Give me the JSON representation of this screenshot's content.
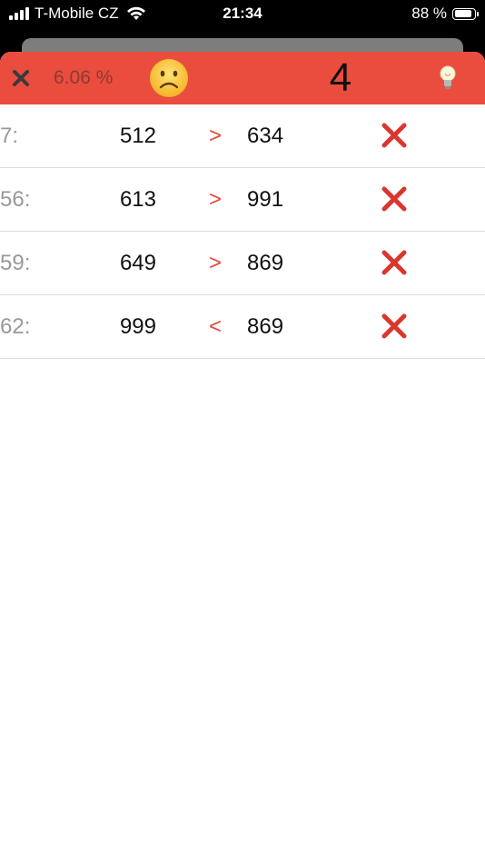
{
  "status": {
    "carrier": "T-Mobile CZ",
    "time": "21:34",
    "battery": "88 %",
    "battery_level": 0.88
  },
  "header": {
    "percent": "6.06 %",
    "counter": "4",
    "close_icon": "close-icon",
    "face_icon": "frowning-face-icon",
    "hint_icon": "lightbulb-icon",
    "color": "#ea4d3d"
  },
  "rows": [
    {
      "index": "7:",
      "left": "512",
      "op": ">",
      "right": "634",
      "result_icon": "cross-icon"
    },
    {
      "index": "56:",
      "left": "613",
      "op": ">",
      "right": "991",
      "result_icon": "cross-icon"
    },
    {
      "index": "59:",
      "left": "649",
      "op": ">",
      "right": "869",
      "result_icon": "cross-icon"
    },
    {
      "index": "62:",
      "left": "999",
      "op": "<",
      "right": "869",
      "result_icon": "cross-icon"
    }
  ]
}
